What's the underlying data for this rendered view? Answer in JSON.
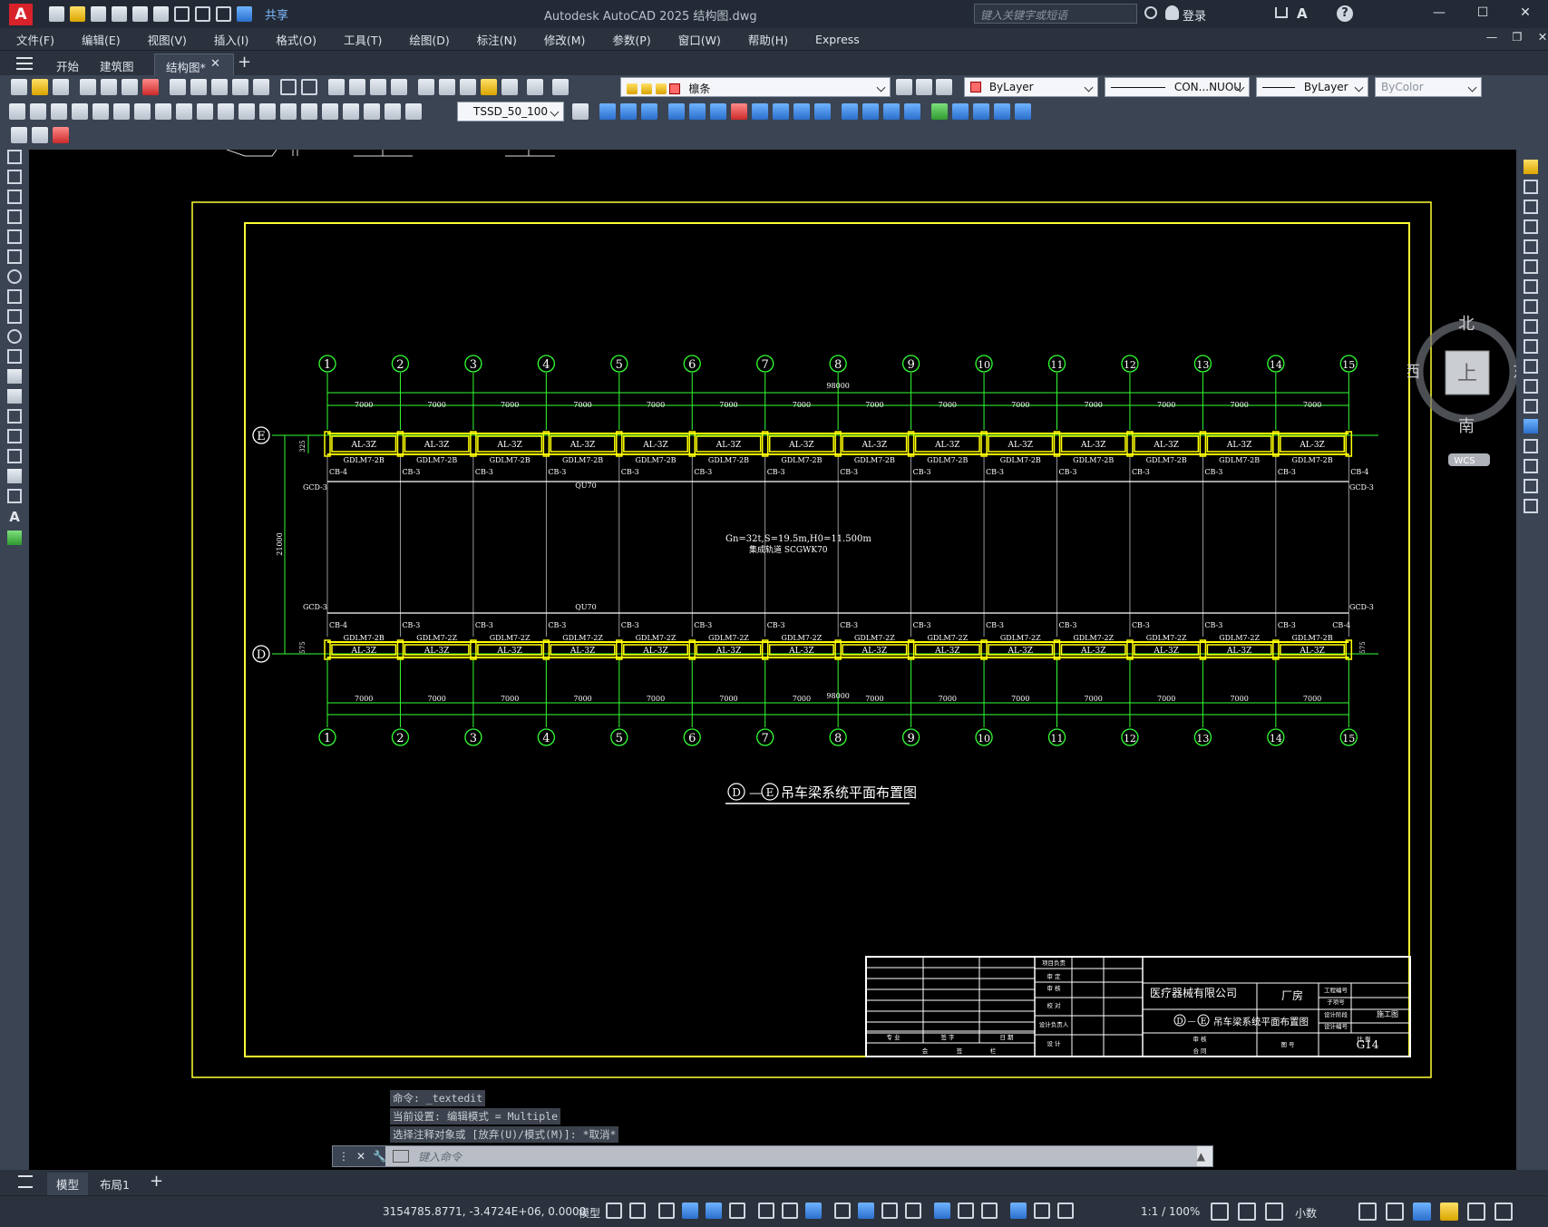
{
  "titlebar": {
    "app_logo": "A",
    "share": "共享",
    "title": "Autodesk AutoCAD 2025    结构图.dwg",
    "search_placeholder": "键入关键字或短语",
    "login": "登录"
  },
  "menu": [
    "文件(F)",
    "编辑(E)",
    "视图(V)",
    "插入(I)",
    "格式(O)",
    "工具(T)",
    "绘图(D)",
    "标注(N)",
    "修改(M)",
    "参数(P)",
    "窗口(W)",
    "帮助(H)",
    "Express"
  ],
  "tabs": {
    "start": "开始",
    "arch": "建筑图",
    "struct": "结构图*"
  },
  "toolbar": {
    "layer": "檩条",
    "color": "ByLayer",
    "linetype": "CON...NUOU",
    "lineweight": "ByLayer",
    "plotstyle": "ByColor",
    "dimstyle": "TSSD_50_100"
  },
  "viewcube": {
    "north": "北",
    "south": "南",
    "east": "东",
    "west": "西",
    "face": "上",
    "wcs": "WCS"
  },
  "drawing": {
    "axes": [
      "1",
      "2",
      "3",
      "4",
      "5",
      "6",
      "7",
      "8",
      "9",
      "10",
      "11",
      "12",
      "13",
      "14",
      "15"
    ],
    "rows": [
      "E",
      "D"
    ],
    "bay": "7000",
    "total": "98000",
    "height": "21000",
    "dim325": "325",
    "dim575": "575",
    "beam_top": "AL-3Z",
    "girder_top": "GDLM7-2B",
    "girder_bot": "GDLM7-2Z",
    "girder_end": "GDLM7-2B",
    "cb3": "CB-3",
    "cb4": "CB-4",
    "gcd": "GCD-3",
    "rail": "QU70",
    "crane_note1": "Gn=32t,S=19.5m,H0=11.500m",
    "crane_note2": "集成轨道 SCGWK70",
    "title_d": "D",
    "title_e": "E",
    "title_dash": "—",
    "title_text": "吊车梁系统平面布置图",
    "tb_company": "医疗器械有限公司",
    "tb_project": "厂房",
    "tb_drawing": "吊车梁系统平面布置图",
    "tb_stage": "施工图",
    "tb_number": "G14",
    "tb_labels": [
      "项目负责",
      "审 定",
      "审 核",
      "校 对",
      "设计负责人",
      "设 计",
      "工程名称",
      "设计阶段",
      "图 号",
      "专 业",
      "签 字",
      "日 期",
      "会",
      "签",
      "栏",
      "审 核",
      "合 同",
      "图 号",
      "比 例",
      "工程编号",
      "子项号",
      "设计编号"
    ]
  },
  "command": {
    "history": [
      "命令: _textedit",
      "当前设置: 编辑模式 = Multiple",
      "选择注释对象或 [放弃(U)/模式(M)]: *取消*"
    ],
    "placeholder": "键入命令"
  },
  "layouts": {
    "model": "模型",
    "layout1": "布局1"
  },
  "status": {
    "coords": "3154785.8771, -3.4724E+06, 0.0000",
    "model": "模型",
    "scale": "1:1 / 100%",
    "units": "小数"
  }
}
